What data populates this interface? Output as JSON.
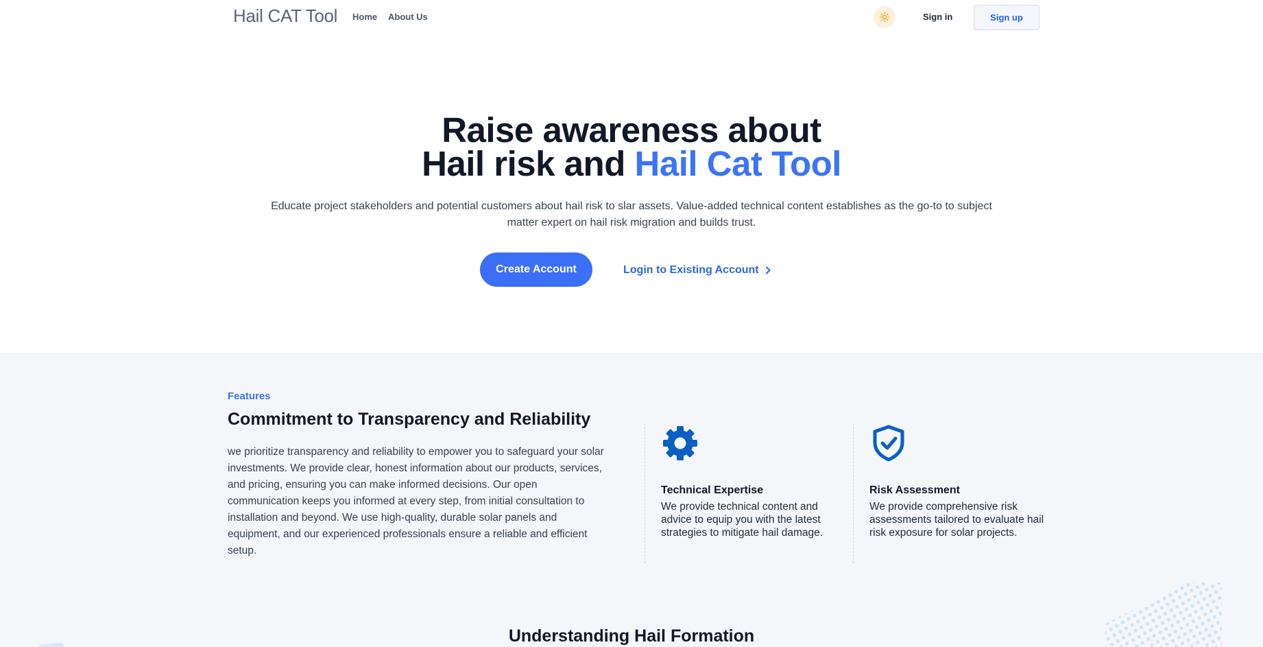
{
  "nav": {
    "brand": "Hail CAT Tool",
    "links": [
      {
        "label": "Home"
      },
      {
        "label": "About Us"
      }
    ],
    "theme_icon": "sun-icon",
    "signin_label": "Sign in",
    "signup_label": "Sign up"
  },
  "hero": {
    "title_line1": "Raise awareness about",
    "title_line2_plain": "Hail risk and ",
    "title_line2_accent": "Hail Cat Tool",
    "description": "Educate project stakeholders and potential customers about hail risk to slar assets. Value-added technical content establishes as the go-to to subject matter expert on hail risk migration and builds trust.",
    "create_label": "Create Account",
    "login_label": "Login to Existing Account",
    "login_icon": "chevron-right-icon"
  },
  "features": {
    "eyebrow": "Features",
    "title": "Commitment to Transparency and Reliability",
    "body": "we prioritize transparency and reliability to empower you to safeguard your solar investments. We provide clear, honest information about our products, services, and pricing, ensuring you can make informed decisions. Our open communication keeps you informed at every step, from initial consultation to installation and beyond. We use high-quality, durable solar panels and equipment, and our experienced professionals ensure a reliable and efficient setup.",
    "cards": [
      {
        "icon": "gear-icon",
        "title": "Technical Expertise",
        "text": "We provide technical content and advice to equip you with the latest strategies to mitigate hail damage."
      },
      {
        "icon": "shield-check-icon",
        "title": "Risk Assessment",
        "text": "We provide comprehensive risk assessments tailored to evaluate hail risk exposure for solar projects."
      }
    ],
    "next_section_title": "Understanding Hail Formation"
  },
  "colors": {
    "accent": "#3b74f5",
    "icon_blue": "#0b5fc1",
    "section_bg": "#f4f6f9"
  }
}
